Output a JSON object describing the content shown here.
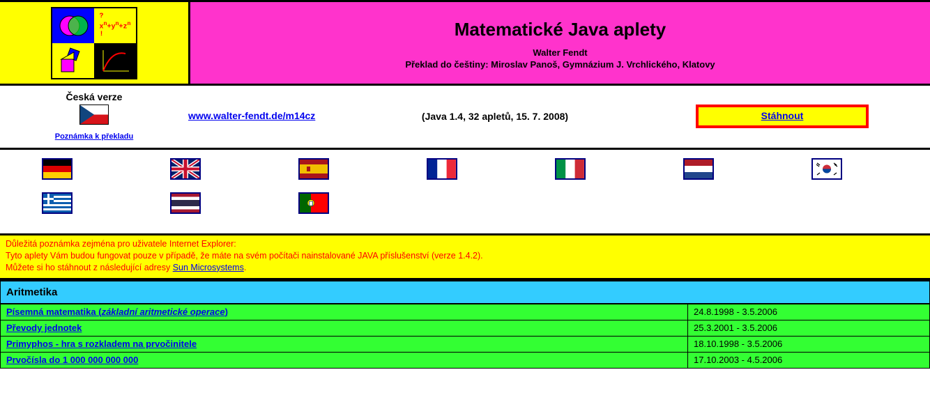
{
  "header": {
    "title": "Matematické Java aplety",
    "author": "Walter Fendt",
    "translator": "Překlad do češtiny: Miroslav Panoš, Gymnázium J. Vrchlického, Klatovy"
  },
  "cz": {
    "version": "Česká verze",
    "note_link": "Poznámka k překladu"
  },
  "main_url": "www.walter-fendt.de/m14cz",
  "java_info": "(Java 1.4, 32 apletů, 15. 7. 2008)",
  "download": "Stáhnout",
  "notice": {
    "line1": "Důležitá poznámka zejména pro uživatele Internet Explorer:",
    "line2a": "Tyto aplety Vám budou fungovat pouze v případě, že máte na svém počítači nainstalované JAVA příslušenství (verze 1.4.2).",
    "line3a": "Můžete si ho stáhnout z následující adresy ",
    "line3_link": "Sun Microsystems",
    "line3b": "."
  },
  "section": "Aritmetika",
  "apps": [
    {
      "name_a": "Písemná matematika (",
      "name_i": "základní aritmetické operace",
      "name_b": ")",
      "date": "24.8.1998 - 3.5.2006"
    },
    {
      "name_a": "Převody jednotek",
      "name_i": "",
      "name_b": "",
      "date": "25.3.2001 - 3.5.2006"
    },
    {
      "name_a": "Primyphos - hra s rozkladem na prvočinitele",
      "name_i": "",
      "name_b": "",
      "date": "18.10.1998 - 3.5.2006"
    },
    {
      "name_a": "Prvočísla do 1 000 000 000 000",
      "name_i": "",
      "name_b": "",
      "date": "17.10.2003 - 4.5.2006"
    }
  ]
}
